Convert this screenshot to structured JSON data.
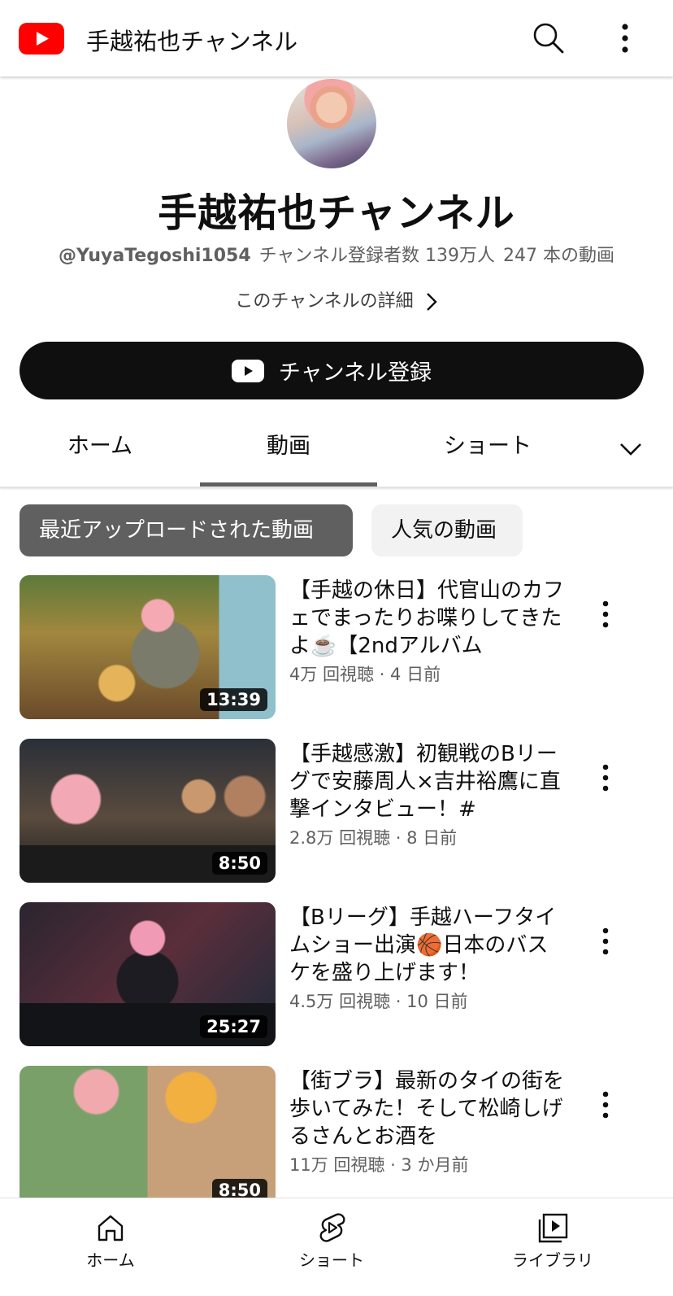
{
  "header": {
    "title": "手越祐也チャンネル"
  },
  "channel": {
    "name": "手越祐也チャンネル",
    "handle": "@YuyaTegoshi1054",
    "subscribers": "チャンネル登録者数 139万人",
    "video_count": "247 本の動画",
    "details_link": "このチャンネルの詳細",
    "subscribe_label": "チャンネル登録"
  },
  "tabs": [
    {
      "label": "ホーム",
      "active": false
    },
    {
      "label": "動画",
      "active": true
    },
    {
      "label": "ショート",
      "active": false
    }
  ],
  "chips": [
    {
      "label": "最近アップロードされた動画",
      "selected": true
    },
    {
      "label": "人気の動画",
      "selected": false
    }
  ],
  "videos": [
    {
      "title": "【手越の休日】代官山のカフェでまったりお喋りしてきたよ☕️【2ndアルバム",
      "meta": "4万 回視聴 · 4 日前",
      "duration": "13:39"
    },
    {
      "title": "【手越感激】初観戦のBリーグで安藤周人×吉井裕鷹に直撃インタビュー！#",
      "meta": "2.8万 回視聴 · 8 日前",
      "duration": "8:50"
    },
    {
      "title": "【Bリーグ】手越ハーフタイムショー出演🏀日本のバスケを盛り上げます！",
      "meta": "4.5万 回視聴 · 10 日前",
      "duration": "25:27"
    },
    {
      "title": "【街ブラ】最新のタイの街を歩いてみた！そして松崎しげるさんとお酒を",
      "meta": "11万 回視聴 · 3 か月前",
      "duration": "8:50"
    }
  ],
  "bottom_nav": [
    {
      "label": "ホーム",
      "icon": "home-icon"
    },
    {
      "label": "ショート",
      "icon": "shorts-icon"
    },
    {
      "label": "ライブラリ",
      "icon": "library-icon"
    }
  ],
  "colors": {
    "brand_red": "#ff0000",
    "subscribe_bg": "#0f0f0f",
    "chip_selected_bg": "#606060",
    "chip_bg": "#f2f2f2",
    "meta_text": "#606060"
  }
}
